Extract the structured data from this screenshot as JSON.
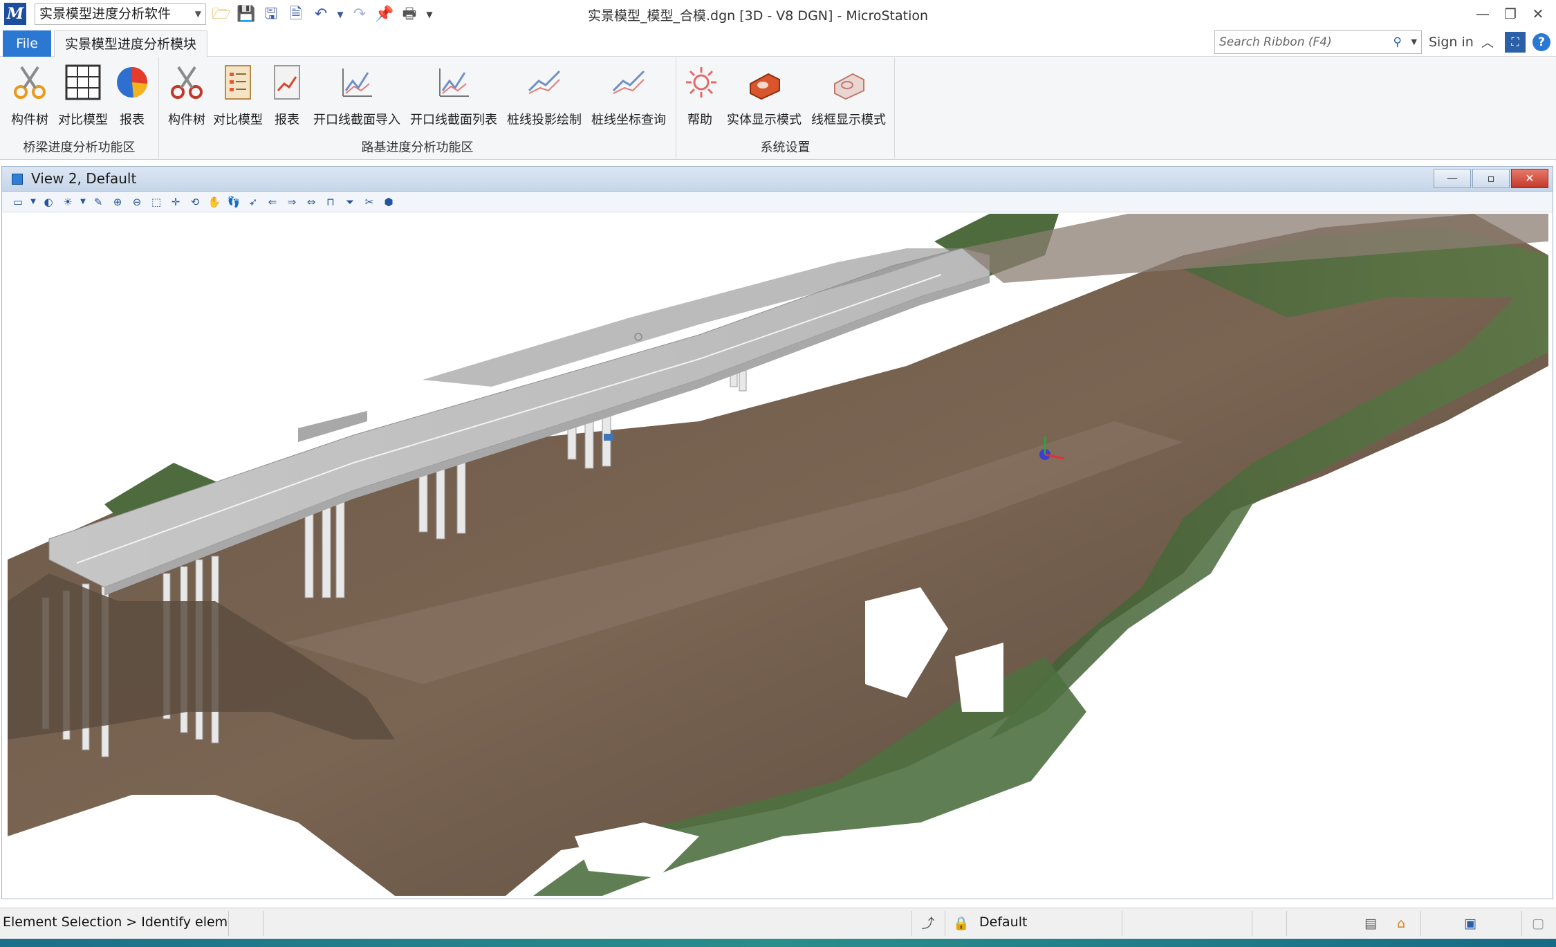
{
  "qat": {
    "workspace": "实景模型进度分析软件",
    "icons": [
      "open-folder-icon",
      "save-icon",
      "save-all-icon",
      "compress-icon",
      "undo-icon",
      "undo-dropdown-icon",
      "redo-icon",
      "pin-icon",
      "print-icon",
      "customize-qat-icon"
    ]
  },
  "window": {
    "title": "实景模型_模型_合模.dgn [3D - V8 DGN] - MicroStation"
  },
  "tabs": {
    "file": "File",
    "module": "实景模型进度分析模块"
  },
  "search": {
    "placeholder": "Search Ribbon (F4)"
  },
  "account": {
    "signin": "Sign in"
  },
  "ribbon": {
    "groups": [
      {
        "title": "桥梁进度分析功能区",
        "buttons": [
          {
            "label": "构件树",
            "icon": "scissors-icon"
          },
          {
            "label": "对比模型",
            "icon": "grid-icon"
          },
          {
            "label": "报表",
            "icon": "pie-chart-icon"
          }
        ]
      },
      {
        "title": "路基进度分析功能区",
        "buttons": [
          {
            "label": "构件树",
            "icon": "scissors-icon"
          },
          {
            "label": "对比模型",
            "icon": "document-list-icon"
          },
          {
            "label": "报表",
            "icon": "report-chart-icon"
          },
          {
            "label": "开口线截面导入",
            "icon": "line-chart-icon"
          },
          {
            "label": "开口线截面列表",
            "icon": "line-chart-icon"
          },
          {
            "label": "桩线投影绘制",
            "icon": "trend-line-icon"
          },
          {
            "label": "桩线坐标查询",
            "icon": "trend-line-icon"
          }
        ]
      },
      {
        "title": "系统设置",
        "buttons": [
          {
            "label": "帮助",
            "icon": "gear-outline-icon"
          },
          {
            "label": "实体显示模式",
            "icon": "solid-block-icon"
          },
          {
            "label": "线框显示模式",
            "icon": "wireframe-block-icon"
          }
        ]
      }
    ]
  },
  "view": {
    "title": "View 2, Default"
  },
  "status": {
    "prompt": "Element Selection > Identify elem",
    "level": "Default"
  },
  "colors": {
    "file_tab": "#2b78d3",
    "view_title_bg": "#c6d5e9",
    "terrain": "#6e5a47",
    "vegetation": "#4c6b3a",
    "bridge_deck": "#c9c9c9"
  }
}
